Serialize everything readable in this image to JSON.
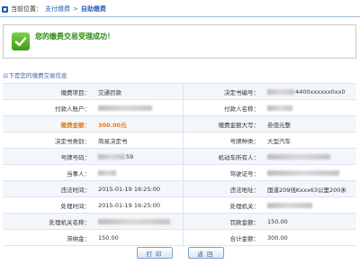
{
  "breadcrumb": {
    "prefix": "当前位置：",
    "parent": "支付缴费",
    "separator": ">",
    "current": "自助缴费"
  },
  "success": {
    "message": "您的缴费交易受理成功！"
  },
  "section_title": "以下是您的缴费交易信息",
  "rows": [
    {
      "l1": "缴费项目：",
      "v1": "交通罚款",
      "l2": "决定书编号：",
      "v2": "4400xxxxxx0xx0"
    },
    {
      "l1": "付款人账户：",
      "v1": "",
      "l2": "付款人名称：",
      "v2": ""
    },
    {
      "l1": "缴费金额：",
      "v1": "300.00元",
      "l2": "缴费金额大写：",
      "v2": "叁佰元整"
    },
    {
      "l1": "决定书类别：",
      "v1": "简易决定书",
      "l2": "号牌种类：",
      "v2": "大型汽车"
    },
    {
      "l1": "号牌号码：",
      "v1": "59",
      "l2": "机动车所有人：",
      "v2": ""
    },
    {
      "l1": "当事人：",
      "v1": "",
      "l2": "驾驶证号：",
      "v2": ""
    },
    {
      "l1": "违法时间：",
      "v1": "2015-01-19 16:25:00",
      "l2": "违法地址：",
      "v2": "国道209线Kxxx63公里200米"
    },
    {
      "l1": "处理时间：",
      "v1": "2015-01-19 16:25:00",
      "l2": "处理机关：",
      "v2": ""
    },
    {
      "l1": "处理机关名称：",
      "v1": "",
      "l2": "罚款金额：",
      "v2": "150.00"
    },
    {
      "l1": "滞纳金：",
      "v1": "150.00",
      "l2": "合计金额：",
      "v2": "300.00"
    }
  ],
  "buttons": {
    "print": "打 印",
    "back": "返 回"
  }
}
